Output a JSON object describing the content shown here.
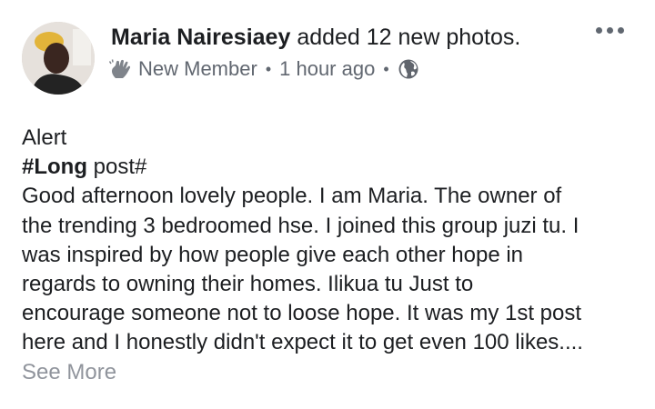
{
  "post": {
    "author": "Maria Nairesiaey",
    "action": "added 12 new photos.",
    "badge": "New Member",
    "separator": "•",
    "time": "1 hour ago",
    "audience_icon": "globe-icon",
    "badge_icon": "wave-hand-icon",
    "menu_icon": "more-options-icon"
  },
  "body": {
    "line1": "Alert",
    "hashtag_bold": "#Long",
    "hashtag_rest": " post#",
    "lines": [
      "Good afternoon lovely people. I am Maria. The owner of",
      "the trending 3 bedroomed hse. I joined this group juzi tu. I",
      "was inspired by how people give each other hope in",
      "regards to owning their homes. Ilikua tu Just to",
      "encourage someone not to loose hope. It was my 1st post",
      "here and I honestly didn't expect it to get even 100 likes...."
    ],
    "see_more": "See More"
  }
}
